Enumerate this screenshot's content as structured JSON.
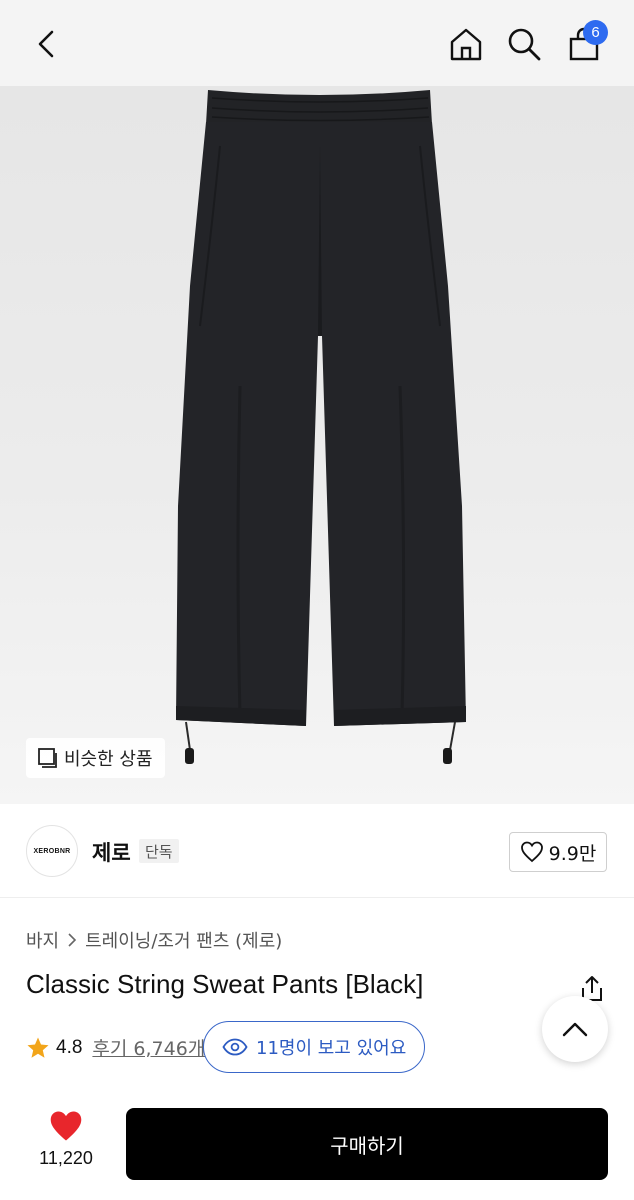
{
  "header": {
    "back_icon": "chevron-left-icon",
    "home_icon": "home-icon",
    "search_icon": "search-icon",
    "cart_icon": "shopping-bag-icon",
    "cart_count": "6",
    "badge_color": "#2e6bf0"
  },
  "hero": {
    "image": "black sweat pants product photo",
    "similar_label": "비슷한 상품",
    "similar_icon": "similar-items-icon"
  },
  "brand": {
    "logo_text": "XEROBNR",
    "name": "제로",
    "tag": "단독",
    "like_count": "9.9만",
    "like_icon": "heart-outline-icon"
  },
  "product": {
    "breadcrumb": [
      "바지",
      "트레이닝/조거 팬츠 (제로)"
    ],
    "title": "Classic String Sweat Pants [Black]",
    "rating": "4.8",
    "reviews": "후기 6,746개",
    "viewers": "11명이 보고 있어요",
    "star_color": "#f2a51a",
    "viewer_color": "#2c5bc2"
  },
  "bottom": {
    "fav_count": "11,220",
    "fav_color": "#e8262c",
    "buy_label": "구매하기"
  }
}
